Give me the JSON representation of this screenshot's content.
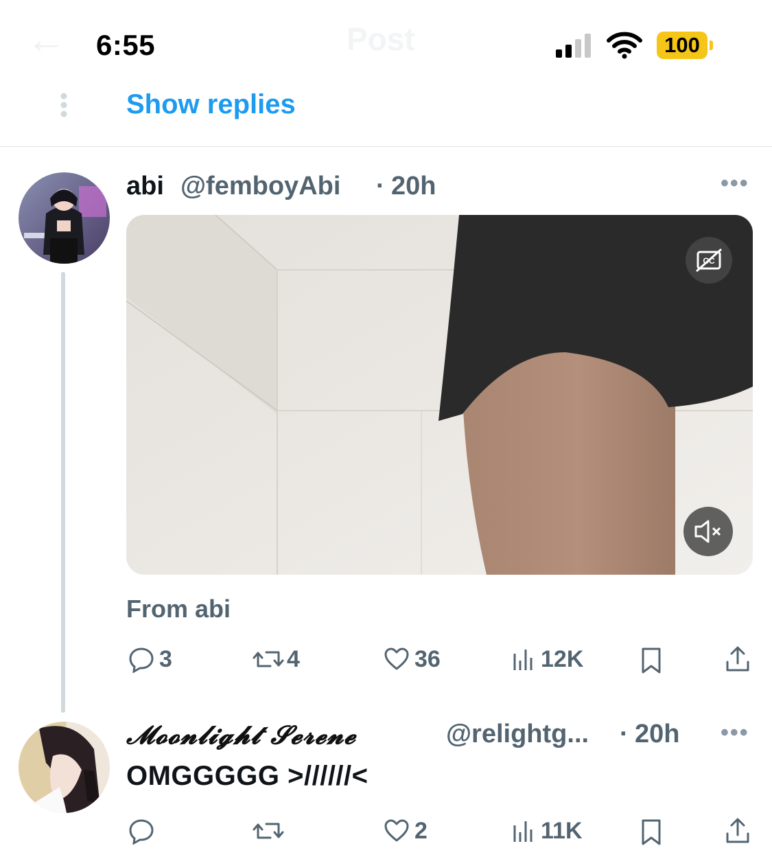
{
  "header": {
    "back_icon": "arrow-left-icon",
    "title": "Post",
    "time": "6:55",
    "battery": "100",
    "signal_icon": "cell-signal-icon",
    "wifi_icon": "wifi-icon"
  },
  "thread": {
    "show_replies_label": "Show replies"
  },
  "tweet1": {
    "name": "abi",
    "handle": "@femboyAbi",
    "separator": "·",
    "time": "20h",
    "media": {
      "type": "video",
      "cc_icon": "captions-off-icon",
      "mute_icon": "speaker-muted-icon"
    },
    "source_label": "From abi",
    "actions": {
      "replies": "3",
      "reposts": "4",
      "likes": "36",
      "views": "12K"
    }
  },
  "tweet2": {
    "name": "𝓜𝓸𝓸𝓷𝓵𝓲𝓰𝓱𝓽 𝓢𝓮𝓻𝓮𝓷𝓮",
    "handle": "@relightg...",
    "separator": "·",
    "time": "20h",
    "text": "OMGGGGG >//////<",
    "actions": {
      "replies": "",
      "reposts": "",
      "likes": "2",
      "views": "11K"
    }
  },
  "colors": {
    "accent": "#1d9bf0",
    "secondary_text": "#536471",
    "battery": "#f5c518",
    "divider": "#e1e6ea",
    "thread_line": "#cfd9de"
  }
}
